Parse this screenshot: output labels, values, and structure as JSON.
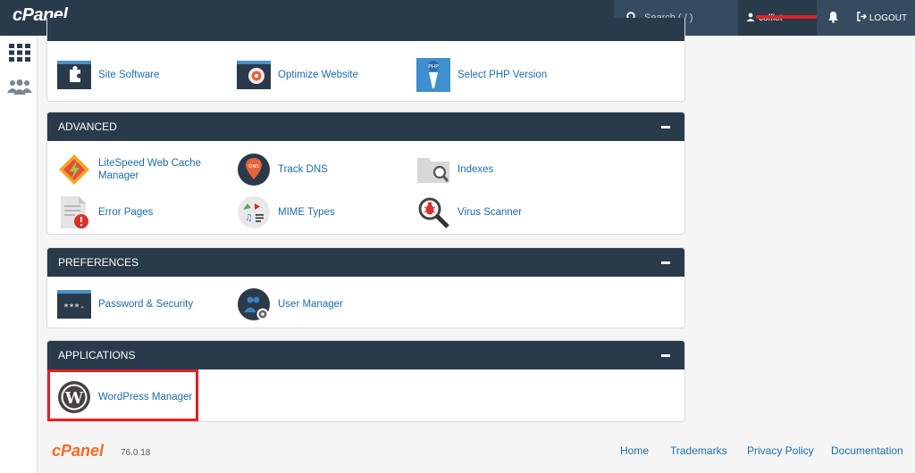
{
  "app": {
    "logo": "cPanel"
  },
  "topbar": {
    "search_placeholder": "Search ( / )",
    "username": "cofflet",
    "logout_label": "LOGOUT"
  },
  "software": {
    "items": [
      {
        "label": "Site Software",
        "icon": "puzzle-icon"
      },
      {
        "label": "Optimize Website",
        "icon": "optimize-icon"
      },
      {
        "label": "Select PHP Version",
        "icon": "php-icon"
      }
    ]
  },
  "advanced": {
    "title": "ADVANCED",
    "items": [
      {
        "label": "LiteSpeed Web Cache Manager",
        "icon": "litespeed-icon"
      },
      {
        "label": "Track DNS",
        "icon": "dns-icon"
      },
      {
        "label": "Indexes",
        "icon": "folder-search-icon"
      },
      {
        "label": "Error Pages",
        "icon": "error-page-icon"
      },
      {
        "label": "MIME Types",
        "icon": "mime-icon"
      },
      {
        "label": "Virus Scanner",
        "icon": "virus-scanner-icon"
      }
    ]
  },
  "preferences": {
    "title": "PREFERENCES",
    "items": [
      {
        "label": "Password & Security",
        "icon": "password-icon"
      },
      {
        "label": "User Manager",
        "icon": "user-manager-icon"
      }
    ]
  },
  "applications": {
    "title": "APPLICATIONS",
    "items": [
      {
        "label": "WordPress Manager",
        "icon": "wordpress-icon"
      }
    ]
  },
  "footer": {
    "logo": "cPanel",
    "version": "76.0.18",
    "links": [
      "Home",
      "Trademarks",
      "Privacy Policy",
      "Documentation"
    ]
  },
  "colors": {
    "header": "#293a4a",
    "link": "#1b6db0",
    "highlight": "#e41f1f",
    "brand_orange": "#f26c22"
  }
}
